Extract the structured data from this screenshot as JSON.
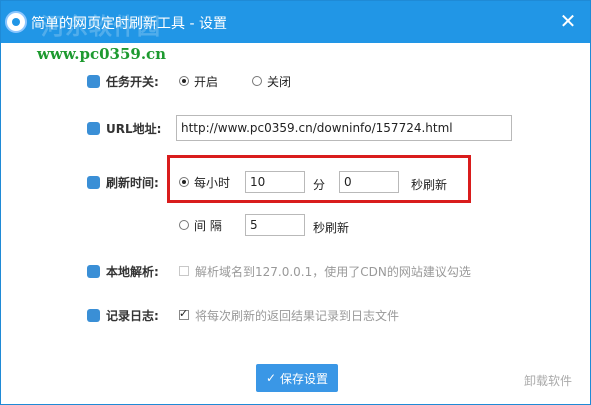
{
  "window": {
    "title": "简单的网页定时刷新工具 - 设置",
    "watermark": "河东软件园",
    "watermark_url": "www.pc0359.cn",
    "close_glyph": "✕"
  },
  "task_switch": {
    "label": "任务开关:",
    "on_label": "开启",
    "off_label": "关闭",
    "selected": "开启"
  },
  "url": {
    "label": "URL地址:",
    "value": "http://www.pc0359.cn/downinfo/157724.html"
  },
  "refresh": {
    "label": "刷新时间:",
    "hourly_label": "每小时",
    "minutes_value": "10",
    "minutes_unit": "分",
    "seconds_value": "0",
    "seconds_suffix": "秒刷新",
    "interval_label": "间 隔",
    "interval_value": "5",
    "interval_suffix": "秒刷新",
    "selected": "每小时"
  },
  "local_resolve": {
    "label": "本地解析:",
    "text": "解析域名到127.0.0.1，使用了CDN的网站建议勾选",
    "checked": false
  },
  "log": {
    "label": "记录日志:",
    "text": "将每次刷新的返回结果记录到日志文件",
    "checked": true
  },
  "buttons": {
    "save": "保存设置",
    "uninstall": "卸载软件"
  },
  "colors": {
    "titlebar": "#2196e6",
    "highlight": "#d91c1c",
    "save_button": "#3a97e6"
  }
}
